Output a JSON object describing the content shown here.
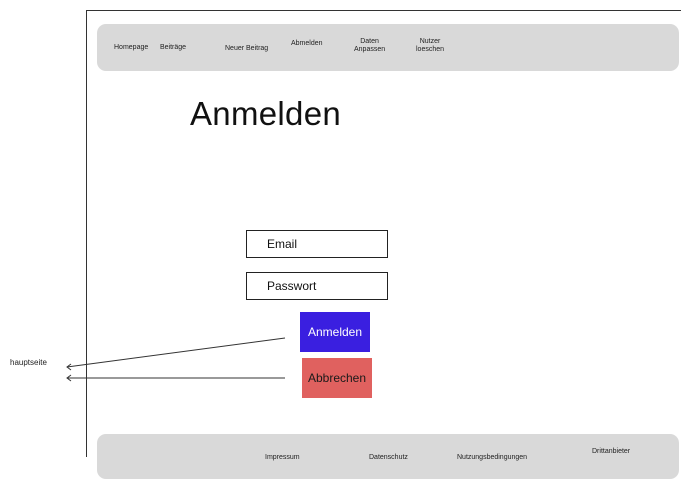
{
  "nav": {
    "homepage": "Homepage",
    "beitraege": "Beiträge",
    "neuer_beitrag": "Neuer Beitrag",
    "abmelden": "Abmelden",
    "daten_anpassen_1": "Daten",
    "daten_anpassen_2": "Anpassen",
    "nutzer_loeschen_1": "Nutzer",
    "nutzer_loeschen_2": "loeschen"
  },
  "page": {
    "title": "Anmelden"
  },
  "form": {
    "email_placeholder": "Email",
    "password_placeholder": "Passwort",
    "login_label": "Anmelden",
    "cancel_label": "Abbrechen"
  },
  "annotation": {
    "target_label": "hauptseite"
  },
  "footer": {
    "impressum": "Impressum",
    "datenschutz": "Datenschutz",
    "nutzungsbedingungen": "Nutzungsbedingungen",
    "drittanbieter": "Drittanbieter"
  },
  "colors": {
    "nav_bg": "#d9d9d9",
    "login_button": "#3a1fe0",
    "cancel_button": "#e0615f"
  }
}
